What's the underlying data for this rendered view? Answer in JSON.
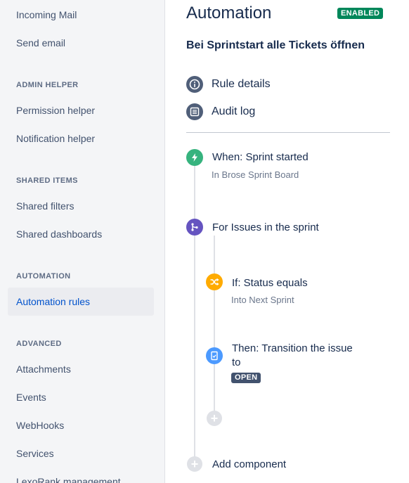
{
  "sidebar": {
    "items": [
      {
        "label": "Incoming Mail"
      },
      {
        "label": "Send email"
      },
      {
        "label": "Permission helper"
      },
      {
        "label": "Notification helper"
      },
      {
        "label": "Shared filters"
      },
      {
        "label": "Shared dashboards"
      },
      {
        "label": "Automation rules",
        "selected": true
      },
      {
        "label": "Attachments"
      },
      {
        "label": "Events"
      },
      {
        "label": "WebHooks"
      },
      {
        "label": "Services"
      },
      {
        "label": "LexoRank management"
      }
    ],
    "headers": {
      "admin_helper": "ADMIN HELPER",
      "shared_items": "SHARED ITEMS",
      "automation": "AUTOMATION",
      "advanced": "ADVANCED"
    }
  },
  "main": {
    "title": "Automation",
    "status_badge": "ENABLED",
    "rule_name": "Bei Sprintstart alle Tickets öffnen",
    "links": {
      "rule_details": "Rule details",
      "audit_log": "Audit log"
    },
    "components": {
      "trigger_title": "When: Sprint started",
      "trigger_sub": "In Brose Sprint Board",
      "branch_title": "For Issues in the sprint",
      "condition_title": "If: Status equals",
      "condition_sub": "Into Next Sprint",
      "action_title_line1": "Then: Transition the issue",
      "action_title_line2": "to",
      "action_status": "OPEN",
      "add_component": "Add component"
    }
  },
  "colors": {
    "enabled": "#00875a",
    "trigger": "#36b37e",
    "branch": "#6554c0",
    "condition": "#ffab00",
    "action": "#4c9aff",
    "selected_text": "#0052cc"
  }
}
